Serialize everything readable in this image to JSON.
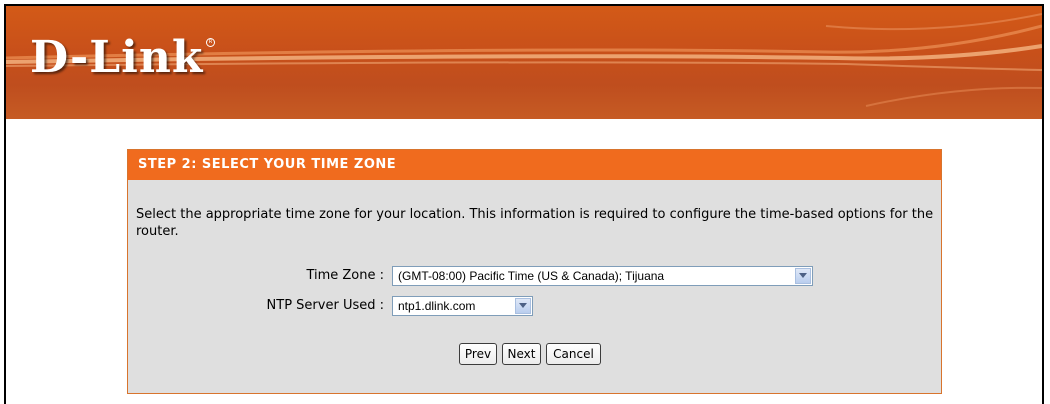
{
  "brand": {
    "logo": "D-Link",
    "mark": "R"
  },
  "wizard": {
    "step_title": "STEP 2: SELECT YOUR TIME ZONE",
    "description": "Select the appropriate time zone for your location. This information is required to configure the time-based options for the router.",
    "time_zone": {
      "label": "Time Zone :",
      "value": "(GMT-08:00) Pacific Time (US & Canada); Tijuana"
    },
    "ntp_server": {
      "label": "NTP Server Used :",
      "value": "ntp1.dlink.com"
    },
    "buttons": {
      "prev": "Prev",
      "next": "Next",
      "cancel": "Cancel"
    }
  },
  "colors": {
    "header_orange": "#f06b1e",
    "banner_orange": "#c8501a",
    "panel_grey": "#dfdfdf"
  },
  "icons": {
    "dropdown": "chevron-down-icon"
  }
}
